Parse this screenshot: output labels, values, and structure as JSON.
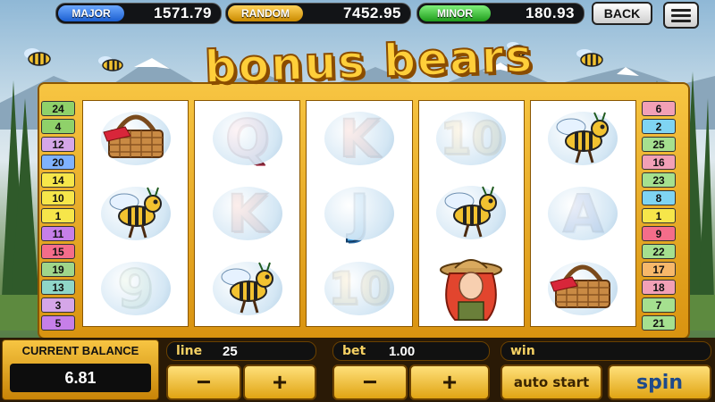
{
  "jackpots": {
    "major": {
      "label": "MAJOR",
      "value": "1571.79"
    },
    "random": {
      "label": "RANDOM",
      "value": "7452.95"
    },
    "minor": {
      "label": "MINOR",
      "value": "180.93"
    }
  },
  "nav": {
    "back_label": "BACK"
  },
  "logo": {
    "title": "bonus bears"
  },
  "paylines": {
    "left": [
      {
        "n": "24",
        "color": "#8fd16a"
      },
      {
        "n": "4",
        "color": "#8fd16a"
      },
      {
        "n": "12",
        "color": "#d5a6e8"
      },
      {
        "n": "20",
        "color": "#7fb2ff"
      },
      {
        "n": "14",
        "color": "#f6e64a"
      },
      {
        "n": "10",
        "color": "#f6e64a"
      },
      {
        "n": "1",
        "color": "#f6e64a"
      },
      {
        "n": "11",
        "color": "#c67fe8"
      },
      {
        "n": "15",
        "color": "#f46d8a"
      },
      {
        "n": "19",
        "color": "#9fd68a"
      },
      {
        "n": "13",
        "color": "#8fd6c8"
      },
      {
        "n": "3",
        "color": "#d5a6e8"
      },
      {
        "n": "5",
        "color": "#c67fe8"
      }
    ],
    "right": [
      {
        "n": "6",
        "color": "#f2a0b6"
      },
      {
        "n": "2",
        "color": "#7fd4f2"
      },
      {
        "n": "25",
        "color": "#a5e08f"
      },
      {
        "n": "16",
        "color": "#f2a0b6"
      },
      {
        "n": "23",
        "color": "#a5e08f"
      },
      {
        "n": "8",
        "color": "#7fd4f2"
      },
      {
        "n": "1",
        "color": "#f6e64a"
      },
      {
        "n": "9",
        "color": "#f46d8a"
      },
      {
        "n": "22",
        "color": "#a5e08f"
      },
      {
        "n": "17",
        "color": "#f7b86a"
      },
      {
        "n": "18",
        "color": "#f2a0b6"
      },
      {
        "n": "7",
        "color": "#a5e08f"
      },
      {
        "n": "21",
        "color": "#a5e08f"
      }
    ]
  },
  "reels": [
    [
      "picnic-basket",
      "bee",
      "9"
    ],
    [
      "Q",
      "K",
      "bee"
    ],
    [
      "K",
      "J",
      "10"
    ],
    [
      "10",
      "bee",
      "ranger-girl"
    ],
    [
      "bee",
      "A",
      "picnic-basket"
    ]
  ],
  "panel": {
    "balance_label": "CURRENT BALANCE",
    "balance_value": "6.81",
    "line_label": "line",
    "line_value": "25",
    "bet_label": "bet",
    "bet_value": "1.00",
    "win_label": "win",
    "win_value": "",
    "minus": "−",
    "plus": "+",
    "auto_start_label": "auto start",
    "spin_label": "spin"
  }
}
